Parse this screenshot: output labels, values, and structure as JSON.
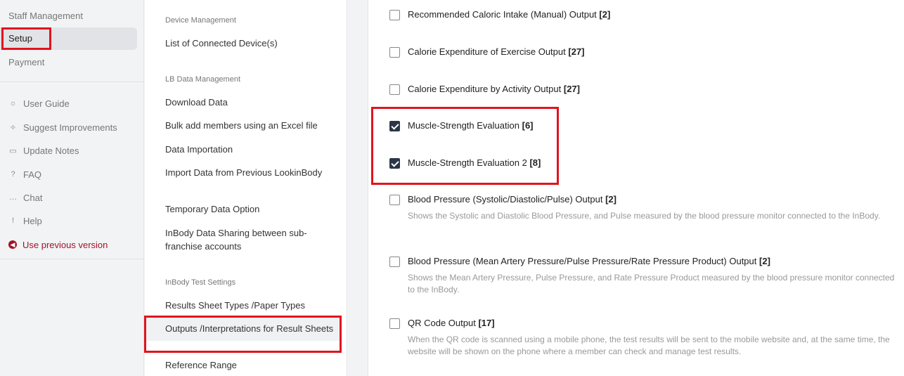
{
  "sidebar": {
    "nav": [
      "Staff Management",
      "Setup",
      "Payment"
    ],
    "links": [
      {
        "label": "User Guide",
        "icon": "lightbulb-icon",
        "glyph": "☼"
      },
      {
        "label": "Suggest Improvements",
        "icon": "sparkle-icon",
        "glyph": "✧"
      },
      {
        "label": "Update Notes",
        "icon": "book-icon",
        "glyph": "▭"
      },
      {
        "label": "FAQ",
        "icon": "question-icon",
        "glyph": "?"
      },
      {
        "label": "Chat",
        "icon": "chat-icon",
        "glyph": "…"
      },
      {
        "label": "Help",
        "icon": "help-icon",
        "glyph": "!"
      }
    ],
    "previous_version": "Use previous version"
  },
  "menu": {
    "sections": {
      "device": "Device Management",
      "lb_data": "LB Data Management",
      "test_settings": "InBody Test Settings"
    },
    "items": [
      "List of Connected Device(s)",
      "Download Data",
      "Bulk add members using an Excel file",
      "Data Importation",
      "Import Data from Previous LookinBody",
      "Temporary Data Option",
      "InBody Data Sharing between sub-franchise accounts",
      "Results Sheet Types /Paper Types",
      "Outputs /Interpretations for Result Sheets",
      "Reference Range"
    ]
  },
  "outputs": [
    {
      "title": "Recommended Caloric Intake (Manual) Output",
      "count": "[2]",
      "checked": false,
      "desc": ""
    },
    {
      "title": "Calorie Expenditure of Exercise Output",
      "count": "[27]",
      "checked": false,
      "desc": ""
    },
    {
      "title": "Calorie Expenditure by Activity Output",
      "count": "[27]",
      "checked": false,
      "desc": ""
    },
    {
      "title": "Muscle-Strength Evaluation",
      "count": "[6]",
      "checked": true,
      "desc": ""
    },
    {
      "title": "Muscle-Strength Evaluation 2",
      "count": "[8]",
      "checked": true,
      "desc": ""
    },
    {
      "title": "Blood Pressure (Systolic/Diastolic/Pulse) Output",
      "count": "[2]",
      "checked": false,
      "desc": "Shows the Systolic and Diastolic Blood Pressure, and Pulse measured by the blood pressure monitor connected to the InBody."
    },
    {
      "title": "Blood Pressure (Mean Artery Pressure/Pulse Pressure/Rate Pressure Product) Output",
      "count": "[2]",
      "checked": false,
      "desc": "Shows the Mean Artery Pressure, Pulse Pressure, and Rate Pressure Product measured by the blood pressure monitor connected to the InBody."
    },
    {
      "title": "QR Code Output",
      "count": "[17]",
      "checked": false,
      "desc": "When the QR code is scanned using a mobile phone, the test results will be sent to the mobile website and, at the same time, the website will be shown on the phone where a member can check and manage test results."
    }
  ],
  "colors": {
    "highlight": "#e0141e",
    "accent_red": "#a3122a",
    "checkbox_checked": "#2b3546"
  }
}
